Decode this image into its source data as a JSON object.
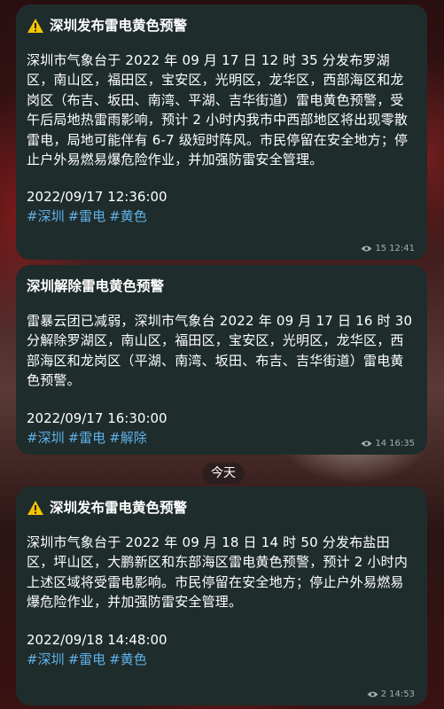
{
  "messages": [
    {
      "title": "深圳发布雷电黄色预警",
      "body": "深圳市气象台于 2022 年 09 月 17 日 12 时 35 分发布罗湖区，南山区，福田区，宝安区，光明区，龙华区，西部海区和龙岗区（布吉、坂田、南湾、平湖、吉华街道）雷电黄色预警，受午后局地热雷雨影响，预计 2 小时内我市中西部地区将出现零散雷电，局地可能伴有 6-7 级短时阵风。市民停留在安全地方；停止户外易燃易爆危险作业，并加强防雷安全管理。",
      "datetime": "2022/09/17 12:36:00",
      "tags": [
        "#深圳",
        "#雷电",
        "#黄色"
      ],
      "views": "15",
      "time": "12:41",
      "icon": "warning-icon"
    },
    {
      "title": "深圳解除雷电黄色预警",
      "body": "雷暴云团已减弱，深圳市气象台 2022 年 09 月 17 日 16 时 30 分解除罗湖区，南山区，福田区，宝安区，光明区，龙华区，西部海区和龙岗区（平湖、南湾、坂田、布吉、吉华街道）雷电黄色预警。",
      "datetime": "2022/09/17 16:30:00",
      "tags": [
        "#深圳",
        "#雷电",
        "#解除"
      ],
      "views": "14",
      "time": "16:35"
    },
    {
      "title": "深圳发布雷电黄色预警",
      "body": "深圳市气象台于 2022 年 09 月 18 日 14 时 50 分发布盐田区，坪山区，大鹏新区和东部海区雷电黄色预警，预计 2 小时内上述区域将受雷电影响。市民停留在安全地方；停止户外易燃易爆危险作业，并加强防雷安全管理。",
      "datetime": "2022/09/18 14:48:00",
      "tags": [
        "#深圳",
        "#雷电",
        "#黄色"
      ],
      "views": "2",
      "time": "14:53",
      "icon": "warning-icon"
    }
  ],
  "date_separator": "今天",
  "colors": {
    "bubble": "#1f2c2c",
    "tag": "#5fb2e8",
    "meta": "#9fb0b0",
    "warning_yellow": "#f5c400"
  }
}
